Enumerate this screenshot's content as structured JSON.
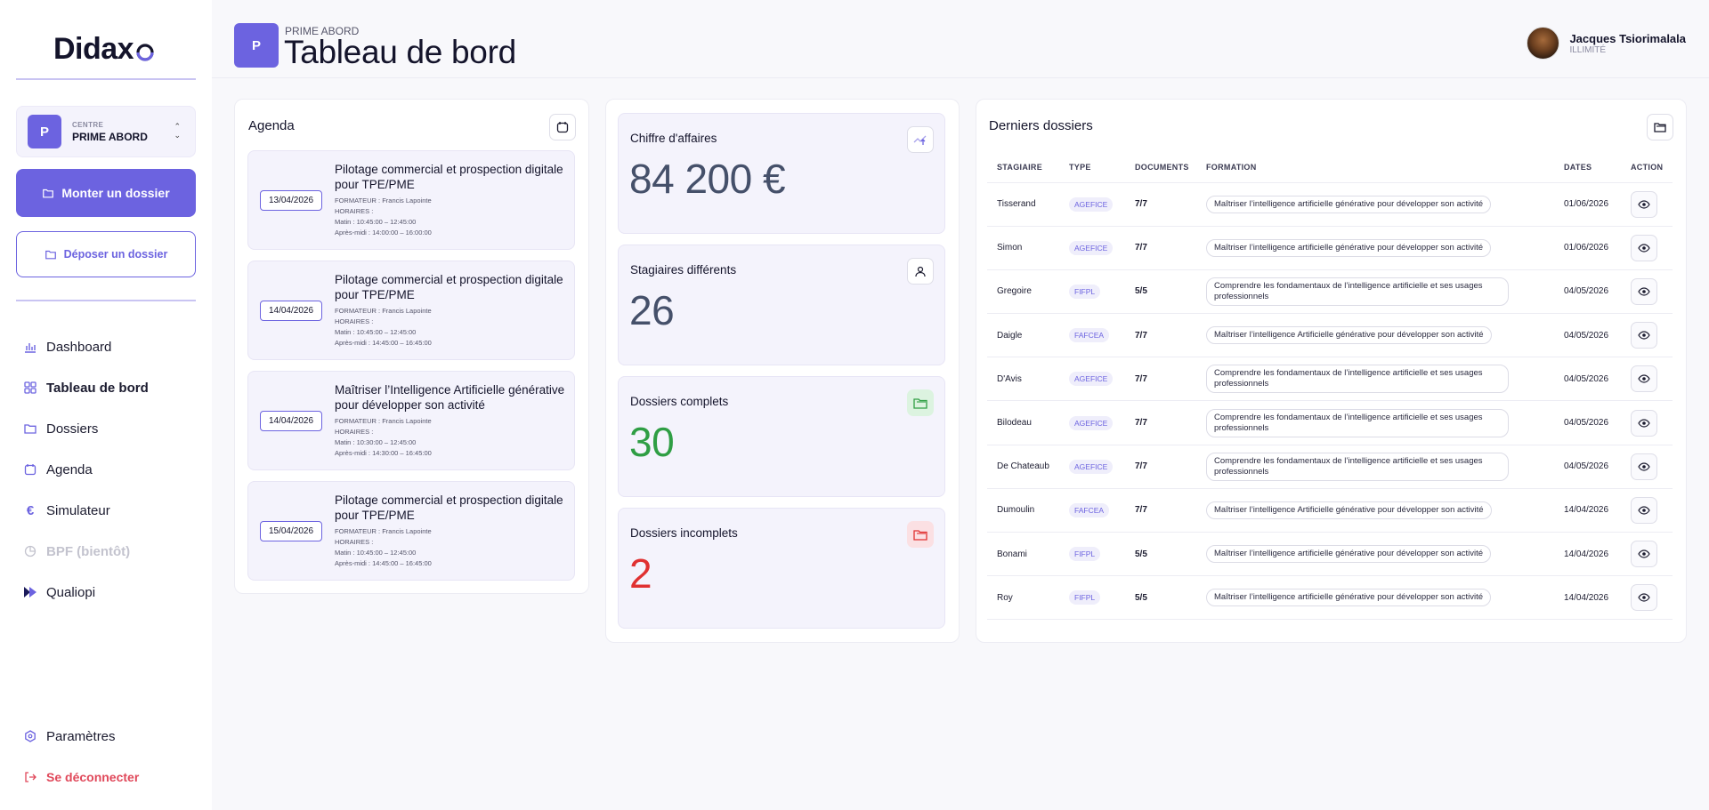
{
  "brand": {
    "name": "Didax"
  },
  "centre": {
    "label": "CENTRE",
    "name": "PRIME ABORD",
    "initial": "P"
  },
  "actions": {
    "primary": "Monter un dossier",
    "secondary": "Déposer un dossier"
  },
  "nav": {
    "items": [
      {
        "label": "Dashboard",
        "icon": "bar-chart-icon",
        "state": "normal"
      },
      {
        "label": "Tableau de bord",
        "icon": "grid-icon",
        "state": "active"
      },
      {
        "label": "Dossiers",
        "icon": "folder-icon",
        "state": "normal"
      },
      {
        "label": "Agenda",
        "icon": "calendar-icon",
        "state": "normal"
      },
      {
        "label": "Simulateur",
        "icon": "euro-icon",
        "state": "normal"
      },
      {
        "label": "BPF (bientôt)",
        "icon": "pie-chart-icon",
        "state": "disabled"
      },
      {
        "label": "Qualiopi",
        "icon": "qualiopi-icon",
        "state": "normal"
      }
    ],
    "settings": "Paramètres",
    "logout": "Se déconnecter"
  },
  "header": {
    "kicker": "PRIME ABORD",
    "title": "Tableau de bord",
    "initial": "P"
  },
  "user": {
    "name": "Jacques Tsiorimalala",
    "plan": "ILLIMITÉ"
  },
  "agenda": {
    "title": "Agenda",
    "items": [
      {
        "date": "13/04/2026",
        "title": "Pilotage commercial et prospection digitale pour TPE/PME",
        "trainer": "FORMATEUR : Francis Lapointe",
        "hours_label": "HORAIRES :",
        "morning": "Matin : 10:45:00 – 12:45:00",
        "afternoon": "Après-midi : 14:00:00 – 16:00:00"
      },
      {
        "date": "14/04/2026",
        "title": "Pilotage commercial et prospection digitale pour TPE/PME",
        "trainer": "FORMATEUR : Francis Lapointe",
        "hours_label": "HORAIRES :",
        "morning": "Matin : 10:45:00 – 12:45:00",
        "afternoon": "Après-midi : 14:45:00 – 16:45:00"
      },
      {
        "date": "14/04/2026",
        "title": "Maîtriser l’Intelligence Artificielle générative pour développer son activité",
        "trainer": "FORMATEUR : Francis Lapointe",
        "hours_label": "HORAIRES :",
        "morning": "Matin : 10:30:00 – 12:45:00",
        "afternoon": "Après-midi : 14:30:00 – 16:45:00"
      },
      {
        "date": "15/04/2026",
        "title": "Pilotage commercial et prospection digitale pour TPE/PME",
        "trainer": "FORMATEUR : Francis Lapointe",
        "hours_label": "HORAIRES :",
        "morning": "Matin : 10:45:00 – 12:45:00",
        "afternoon": "Après-midi : 14:45:00 – 16:45:00"
      }
    ]
  },
  "kpis": [
    {
      "label": "Chiffre d'affaires",
      "value": "84 200 €",
      "color": "#45506a",
      "icon": "trend-up-icon"
    },
    {
      "label": "Stagiaires différents",
      "value": "26",
      "color": "#45506a",
      "icon": "user-icon"
    },
    {
      "label": "Dossiers complets",
      "value": "30",
      "color": "#2f9e44",
      "icon": "folder-check-icon"
    },
    {
      "label": "Dossiers incomplets",
      "value": "2",
      "color": "#e03131",
      "icon": "folder-alert-icon"
    }
  ],
  "dossiers": {
    "title": "Derniers dossiers",
    "columns": [
      "STAGIAIRE",
      "TYPE",
      "DOCUMENTS",
      "FORMATION",
      "DATES",
      "ACTION"
    ],
    "rows": [
      {
        "stagiaire": "Tisserand",
        "type": "AGEFICE",
        "documents": "7/7",
        "formation": "Maîtriser l’intelligence artificielle générative pour développer son activité",
        "date": "01/06/2026"
      },
      {
        "stagiaire": "Simon",
        "type": "AGEFICE",
        "documents": "7/7",
        "formation": "Maîtriser l’intelligence artificielle générative pour développer son activité",
        "date": "01/06/2026"
      },
      {
        "stagiaire": "Gregoire",
        "type": "FIFPL",
        "documents": "5/5",
        "formation": "Comprendre les fondamentaux de l’intelligence artificielle et ses usages professionnels",
        "date": "04/05/2026"
      },
      {
        "stagiaire": "Daigle",
        "type": "FAFCEA",
        "documents": "7/7",
        "formation": "Maîtriser l’intelligence Artificielle générative pour développer son activité",
        "date": "04/05/2026"
      },
      {
        "stagiaire": "D'Avis",
        "type": "AGEFICE",
        "documents": "7/7",
        "formation": "Comprendre les fondamentaux de l’intelligence artificielle et ses usages professionnels",
        "date": "04/05/2026"
      },
      {
        "stagiaire": "Bilodeau",
        "type": "AGEFICE",
        "documents": "7/7",
        "formation": "Comprendre les fondamentaux de l’intelligence artificielle et ses usages professionnels",
        "date": "04/05/2026"
      },
      {
        "stagiaire": "De Chateaub",
        "type": "AGEFICE",
        "documents": "7/7",
        "formation": "Comprendre les fondamentaux de l’intelligence artificielle et ses usages professionnels",
        "date": "04/05/2026"
      },
      {
        "stagiaire": "Dumoulin",
        "type": "FAFCEA",
        "documents": "7/7",
        "formation": "Maîtriser l’intelligence Artificielle générative pour développer son activité",
        "date": "14/04/2026"
      },
      {
        "stagiaire": "Bonami",
        "type": "FIFPL",
        "documents": "5/5",
        "formation": "Maîtriser l’intelligence artificielle générative pour développer son activité",
        "date": "14/04/2026"
      },
      {
        "stagiaire": "Roy",
        "type": "FIFPL",
        "documents": "5/5",
        "formation": "Maîtriser l’intelligence artificielle générative pour développer son activité",
        "date": "14/04/2026"
      }
    ]
  },
  "colors": {
    "accent": "#6c63e0",
    "success": "#2f9e44",
    "danger": "#e03131"
  }
}
